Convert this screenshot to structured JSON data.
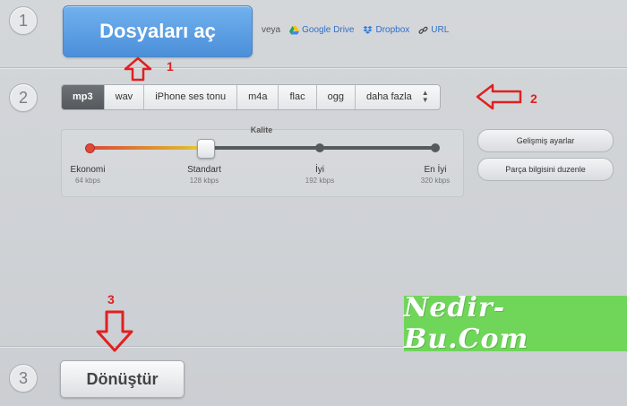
{
  "steps": {
    "step1": "1",
    "step2": "2",
    "step3": "3"
  },
  "open": {
    "label": "Dosyaları aç",
    "or_text": "veya",
    "google_drive": "Google Drive",
    "dropbox": "Dropbox",
    "url": "URL"
  },
  "formats": {
    "items": [
      "mp3",
      "wav",
      "iPhone ses tonu",
      "m4a",
      "flac",
      "ogg",
      "daha fazla"
    ],
    "selected": "mp3"
  },
  "quality": {
    "title": "Kalite",
    "selected_fraction": 0.333,
    "levels": [
      {
        "name": "Ekonomi",
        "bitrate": "64 kbps"
      },
      {
        "name": "Standart",
        "bitrate": "128 kbps"
      },
      {
        "name": "İyi",
        "bitrate": "192 kbps"
      },
      {
        "name": "En İyi",
        "bitrate": "320 kbps"
      }
    ]
  },
  "side_buttons": {
    "advanced": "Gelişmiş ayarlar",
    "track_info": "Parça bilgisini duzenle"
  },
  "convert": {
    "label": "Dönüştür"
  },
  "annotations": {
    "a1": "1",
    "a2": "2",
    "a3": "3"
  },
  "watermark": {
    "text": "Nedir-Bu.Com"
  },
  "colors": {
    "accent_blue": "#4b8fd9",
    "annotation_red": "#e02020",
    "watermark_green": "#6fd65a"
  }
}
